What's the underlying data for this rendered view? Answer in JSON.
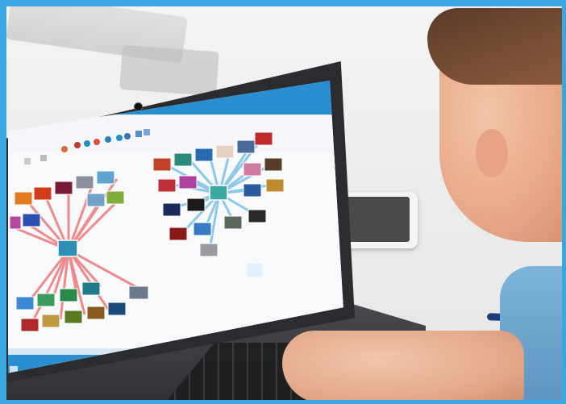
{
  "photo": {
    "description_tags": [
      "laptop",
      "person",
      "phone",
      "pen",
      "desk"
    ]
  },
  "app_window": {
    "title": "",
    "ribbon_tabs": [],
    "ribbon_buttons": [
      {
        "icon": "home-icon"
      },
      {
        "icon": "copy-icon"
      },
      {
        "icon": "paste-icon"
      },
      {
        "icon": "pin-icon"
      },
      {
        "icon": "stop-icon"
      },
      {
        "icon": "palette-icon"
      },
      {
        "icon": "settings-icon"
      },
      {
        "icon": "grid-icon"
      },
      {
        "icon": "image-icon"
      },
      {
        "icon": "share-icon"
      },
      {
        "icon": "map-icon"
      }
    ],
    "status": ""
  },
  "colors": {
    "frame": "#3aa8e0",
    "app_accent": "#2a8fd0",
    "link_left": "#f08a8a",
    "link_right": "#8cc8ec"
  },
  "graph": {
    "left_hub": {
      "label": ""
    },
    "right_hub": {
      "label": ""
    }
  }
}
